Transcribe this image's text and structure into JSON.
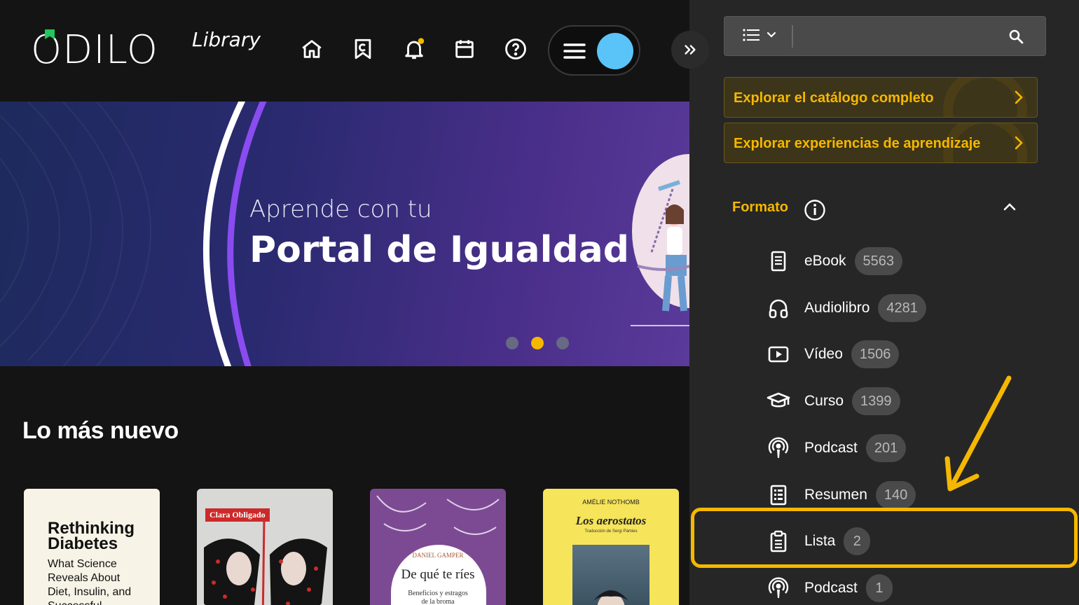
{
  "header": {
    "logo_text": "ODILO",
    "logo_sub": "Library",
    "nav_icons": [
      "home-icon",
      "bookmark-icon",
      "bell-icon",
      "calendar-icon",
      "help-icon"
    ],
    "notification_dot_color": "#f5b800",
    "avatar_color": "#5ac4f8"
  },
  "banner": {
    "subtitle": "Aprende con tu",
    "title": "Portal de Igualdad",
    "active_slide": 2,
    "slide_count": 3
  },
  "section": {
    "title": "Lo más nuevo",
    "books": [
      {
        "title": "Rethinking Diabetes",
        "subtitle": "What Science Reveals About Diet, Insulin, and Successful"
      },
      {
        "author": "Clara Obligado"
      },
      {
        "author": "DANIEL GAMPER",
        "title": "De qué te ríes",
        "subtitle": "Beneficios y estragos de la broma"
      },
      {
        "author": "AMÉLIE NOTHOMB",
        "title": "Los aerostatos",
        "translator": "Traducción de Sergi Pàmies"
      }
    ]
  },
  "sidebar": {
    "search_value": "",
    "explore_buttons": [
      {
        "label": "Explorar el catálogo completo"
      },
      {
        "label": "Explorar experiencias de aprendizaje"
      }
    ],
    "facet": {
      "title": "Formato",
      "items": [
        {
          "name": "eBook",
          "count": "5563",
          "icon": "ebook-icon"
        },
        {
          "name": "Audiolibro",
          "count": "4281",
          "icon": "headphones-icon"
        },
        {
          "name": "Vídeo",
          "count": "1506",
          "icon": "video-icon"
        },
        {
          "name": "Curso",
          "count": "1399",
          "icon": "graduation-cap-icon"
        },
        {
          "name": "Podcast",
          "count": "201",
          "icon": "podcast-icon"
        },
        {
          "name": "Resumen",
          "count": "140",
          "icon": "summary-icon"
        },
        {
          "name": "Lista",
          "count": "2",
          "icon": "clipboard-icon"
        },
        {
          "name": "Podcast",
          "count": "1",
          "icon": "podcast-icon"
        }
      ]
    }
  },
  "colors": {
    "accent": "#f5b800",
    "background": "#141414",
    "sidebar": "#262626"
  }
}
